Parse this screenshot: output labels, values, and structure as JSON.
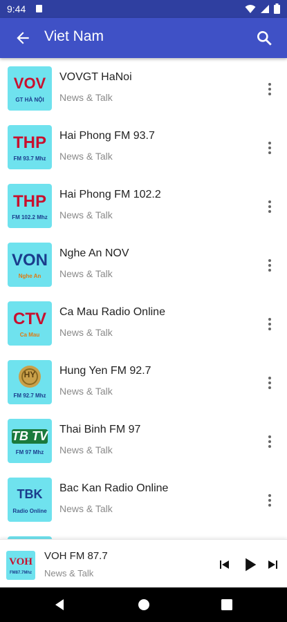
{
  "status": {
    "time": "9:44"
  },
  "appbar": {
    "title": "Viet Nam"
  },
  "stations": [
    {
      "name": "VOVGT HaNoi",
      "category": "News & Talk",
      "logo_big": "VOV",
      "logo_small": "GT HÀ NỘI"
    },
    {
      "name": "Hai Phong FM 93.7",
      "category": "News & Talk",
      "logo_big": "THP",
      "logo_small": "FM 93.7 Mhz"
    },
    {
      "name": "Hai Phong FM 102.2",
      "category": "News & Talk",
      "logo_big": "THP",
      "logo_small": "FM 102.2 Mhz"
    },
    {
      "name": "Nghe An NOV",
      "category": "News & Talk",
      "logo_big": "VON",
      "logo_small": "Nghe An"
    },
    {
      "name": "Ca Mau Radio Online",
      "category": "News & Talk",
      "logo_big": "CTV",
      "logo_small": "Ca Mau"
    },
    {
      "name": "Hung Yen FM 92.7",
      "category": "News & Talk",
      "logo_big": "HY",
      "logo_small": "FM 92.7 Mhz"
    },
    {
      "name": "Thai Binh FM 97",
      "category": "News & Talk",
      "logo_big": "TB TV",
      "logo_small": "FM 97 Mhz"
    },
    {
      "name": "Bac Kan Radio Online",
      "category": "News & Talk",
      "logo_big": "TBK",
      "logo_small": "Radio Online"
    }
  ],
  "player": {
    "name": "VOH FM 87.7",
    "category": "News & Talk",
    "logo_big": "VOH",
    "logo_small": "FM87.7Mhz"
  },
  "colors": {
    "statusbar": "#2f3fa0",
    "appbar": "#3f51c6",
    "logo_bg": "#6fe2ee"
  }
}
